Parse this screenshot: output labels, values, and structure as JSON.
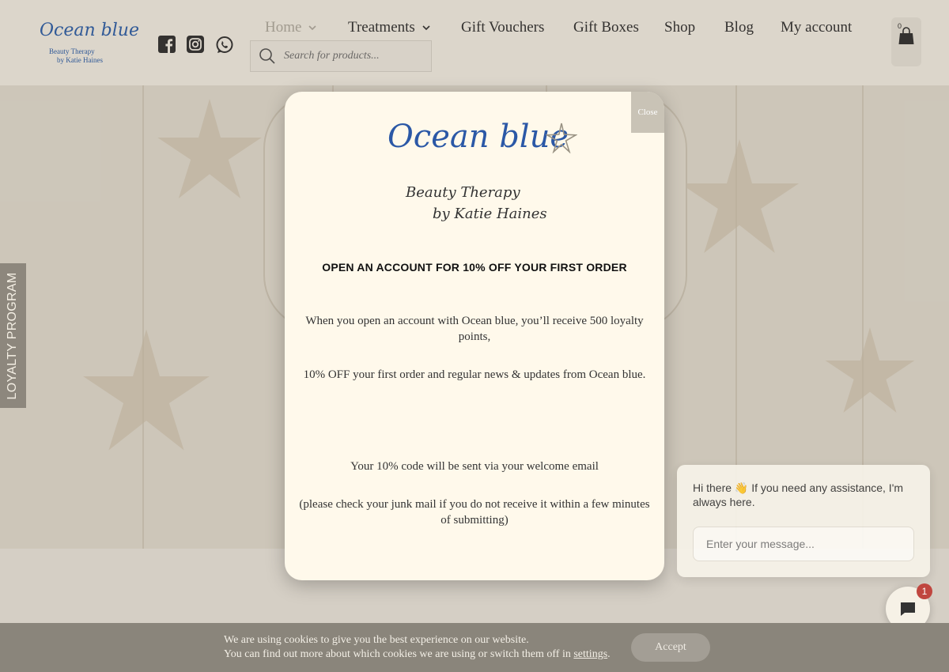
{
  "header": {
    "logo": {
      "main": "Ocean blue",
      "line1": "Beauty Therapy",
      "line2": "by Katie Haines"
    },
    "social": [
      "facebook-icon",
      "instagram-icon",
      "whatsapp-icon"
    ],
    "nav": [
      {
        "label": "Home",
        "dropdown": true,
        "active": true
      },
      {
        "label": "Treatments",
        "dropdown": true
      },
      {
        "label": "Gift Vouchers"
      },
      {
        "label": "Gift Boxes"
      },
      {
        "label": "Shop"
      },
      {
        "label": "Blog"
      },
      {
        "label": "My account"
      }
    ],
    "search": {
      "placeholder": "Search for products..."
    },
    "cart": {
      "count": "0"
    }
  },
  "loyalty_tab": {
    "label": "LOYALTY PROGRAM"
  },
  "modal": {
    "close_label": "Close",
    "logo": {
      "main": "Ocean blue",
      "line1": "Beauty Therapy",
      "line2": "by Katie Haines"
    },
    "heading": "OPEN AN ACCOUNT FOR 10% OFF YOUR FIRST ORDER",
    "para1": "When you open an account with Ocean blue, you’ll receive 500 loyalty points,",
    "para2": "10% OFF your first order and regular news & updates from Ocean blue.",
    "para3": "Your 10% code will be sent via your welcome email",
    "para4": "(please check your junk mail if you do not receive it within a few minutes of submitting)"
  },
  "chat": {
    "greeting_prefix": "Hi there",
    "greeting_emoji": "👋",
    "greeting_rest": "If you need any assistance, I'm always here.",
    "input_placeholder": "Enter your message...",
    "badge": "1"
  },
  "cookie_bar": {
    "line1": "We are using cookies to give you the best experience on our website.",
    "line2_prefix": "You can find out more about which cookies we are using or switch them off in",
    "line2_link": "settings",
    "line2_suffix": ".",
    "accept_label": "Accept"
  },
  "colors": {
    "brand_blue": "#2b58a6",
    "modal_bg": "#fff9eb",
    "cookie_bar": "#8a857b"
  }
}
